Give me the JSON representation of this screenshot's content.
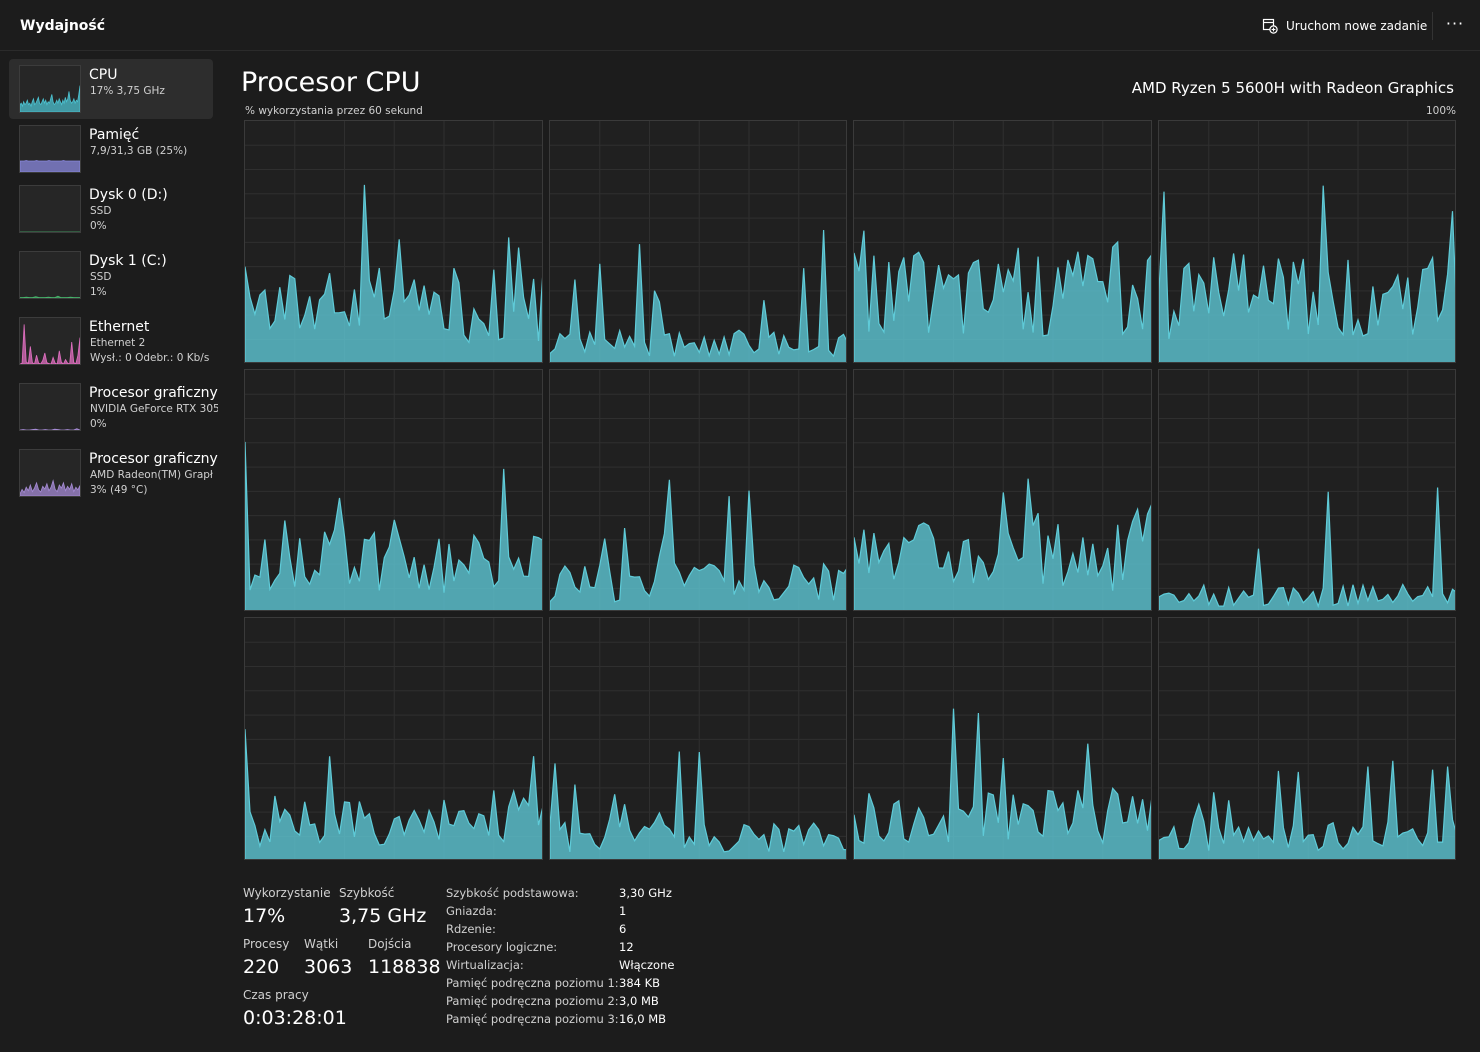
{
  "header": {
    "title": "Wydajność",
    "new_task_label": "Uruchom nowe zadanie",
    "more_label": "···"
  },
  "sidebar": {
    "items": [
      {
        "name": "CPU",
        "lines": [
          "17% 3,75 GHz"
        ],
        "color": "#4cc2d0",
        "points": [
          5,
          6,
          4,
          7,
          5,
          6,
          8,
          5,
          6,
          4,
          7,
          9,
          5,
          6,
          8,
          10,
          6,
          5,
          7,
          9,
          6,
          8,
          5,
          7,
          6,
          9,
          12,
          7,
          5,
          6,
          8,
          6,
          9,
          7,
          5,
          8,
          6,
          10,
          7,
          9,
          14,
          8,
          6,
          7,
          9,
          6,
          8,
          7,
          12,
          18
        ]
      },
      {
        "name": "Pamięć",
        "lines": [
          "7,9/31,3 GB (25%)"
        ],
        "color": "#8b89e0",
        "points": [
          25,
          25,
          25,
          26,
          25,
          25,
          25,
          25,
          26,
          25,
          25,
          25,
          25,
          25,
          26,
          25,
          25,
          25,
          25,
          25,
          25,
          26,
          25,
          25,
          25,
          25,
          25,
          25,
          25,
          25
        ]
      },
      {
        "name": "Dysk 0 (D:)",
        "lines": [
          "SSD",
          "0%"
        ],
        "color": "#47b36b",
        "points": [
          0,
          0,
          0,
          0,
          0,
          0,
          0,
          0,
          0,
          0,
          0,
          0,
          0,
          0,
          0,
          0,
          0,
          0,
          0,
          0
        ]
      },
      {
        "name": "Dysk 1 (C:)",
        "lines": [
          "SSD",
          "1%"
        ],
        "color": "#47b36b",
        "points": [
          1,
          1,
          2,
          1,
          1,
          3,
          1,
          1,
          1,
          2,
          1,
          1,
          4,
          1,
          1,
          1,
          2,
          1,
          1,
          1
        ]
      },
      {
        "name": "Ethernet",
        "lines": [
          "Ethernet 2",
          "Wysł.: 0 Odebr.: 0 Kb/s"
        ],
        "color": "#e06fc0",
        "points": [
          0,
          2,
          90,
          5,
          1,
          40,
          3,
          0,
          20,
          2,
          0,
          8,
          25,
          3,
          1,
          0,
          15,
          2,
          0,
          30,
          4,
          0,
          10,
          2,
          0,
          50,
          3,
          1,
          20,
          60
        ]
      },
      {
        "name": "Procesor graficzny",
        "lines": [
          "NVIDIA GeForce RTX 305",
          "0%"
        ],
        "color": "#a68bd5",
        "points": [
          0,
          1,
          0,
          0,
          1,
          2,
          0,
          0,
          1,
          0,
          0,
          2,
          1,
          0,
          0,
          1,
          0,
          0,
          3,
          0
        ]
      },
      {
        "name": "Procesor graficzny",
        "lines": [
          "AMD Radeon(TM) Grapł",
          "3% (49 °C)"
        ],
        "color": "#a68bd5",
        "points": [
          5,
          15,
          8,
          20,
          12,
          25,
          10,
          18,
          30,
          14,
          9,
          22,
          16,
          28,
          12,
          20,
          35,
          15,
          10,
          25,
          18,
          30,
          12,
          22,
          15,
          28,
          10,
          20,
          14,
          24
        ]
      }
    ]
  },
  "main": {
    "title": "Procesor CPU",
    "cpu_model": "AMD Ryzen 5 5600H with Radeon Graphics",
    "axis_label": "% wykorzystania przez 60 sekund",
    "axis_max": "100%",
    "graph_color": "#5fcbd8",
    "core_count": 12
  },
  "stats": {
    "utilization_label": "Wykorzystanie",
    "utilization": "17%",
    "speed_label": "Szybkość",
    "speed": "3,75 GHz",
    "processes_label": "Procesy",
    "processes": "220",
    "threads_label": "Wątki",
    "threads": "3063",
    "handles_label": "Dojścia",
    "handles": "118838",
    "uptime_label": "Czas pracy",
    "uptime": "0:03:28:01"
  },
  "specs": [
    {
      "key": "Szybkość podstawowa:",
      "value": "3,30 GHz"
    },
    {
      "key": "Gniazda:",
      "value": "1"
    },
    {
      "key": "Rdzenie:",
      "value": "6"
    },
    {
      "key": "Procesory logiczne:",
      "value": "12"
    },
    {
      "key": "Wirtualizacja:",
      "value": "Włączone"
    },
    {
      "key": "Pamięć podręczna poziomu 1:",
      "value": "384 KB"
    },
    {
      "key": "Pamięć podręczna poziomu 2:",
      "value": "3,0 MB"
    },
    {
      "key": "Pamięć podręczna poziomu 3:",
      "value": "16,0 MB"
    }
  ]
}
